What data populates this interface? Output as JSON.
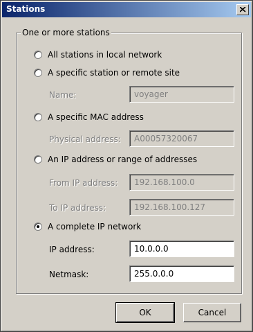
{
  "window": {
    "title": "Stations"
  },
  "group": {
    "legend": "One or more stations"
  },
  "options": {
    "all_local": "All stations in local network",
    "specific_station": "A specific station or remote site",
    "specific_mac": "A specific MAC address",
    "ip_range": "An IP address or range of addresses",
    "ip_network": "A complete IP network",
    "selected": "A complete IP network"
  },
  "fields": {
    "name_label": "Name:",
    "name_value": "voyager",
    "physical_label": "Physical address:",
    "physical_value": "A00057320067",
    "from_ip_label": "From IP address:",
    "from_ip_value": "192.168.100.0",
    "to_ip_label": "To IP address:",
    "to_ip_value": "192.168.100.127",
    "ip_label": "IP address:",
    "ip_value": "10.0.0.0",
    "netmask_label": "Netmask:",
    "netmask_value": "255.0.0.0"
  },
  "buttons": {
    "ok": "OK",
    "cancel": "Cancel"
  }
}
